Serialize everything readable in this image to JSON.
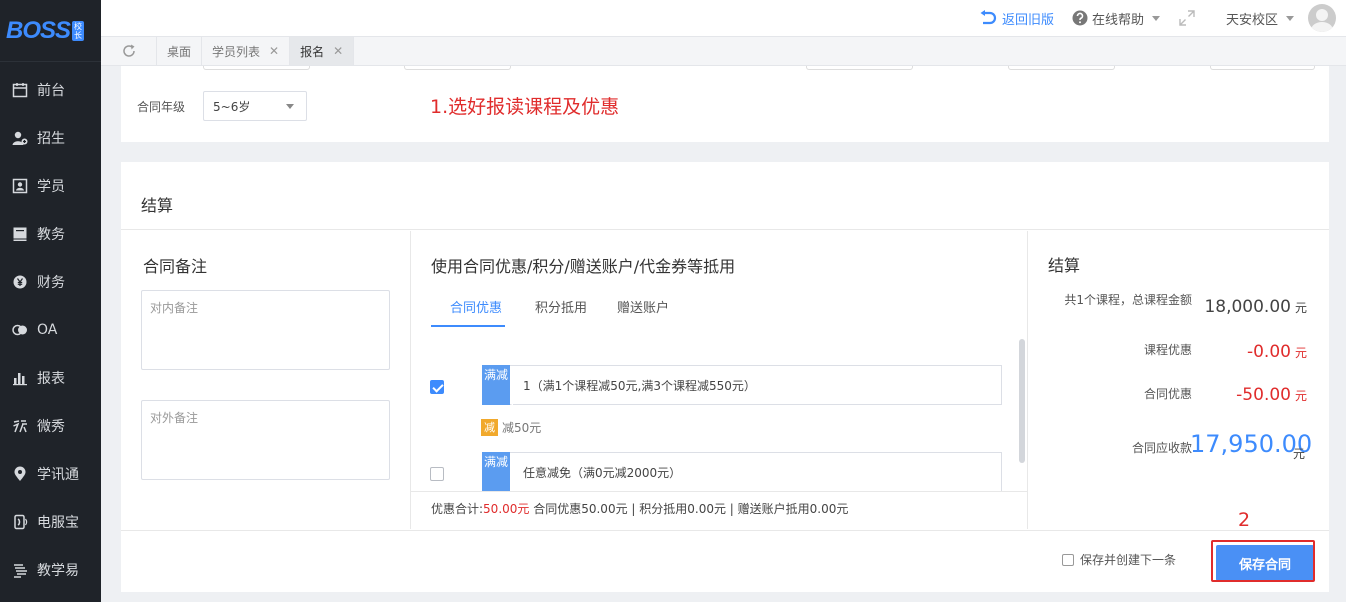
{
  "brand": {
    "logo": "BOSS",
    "tag": "校长"
  },
  "sidebar": {
    "items": [
      {
        "label": "前台",
        "icon": "calendar-icon"
      },
      {
        "label": "招生",
        "icon": "user-add-icon"
      },
      {
        "label": "学员",
        "icon": "id-card-icon"
      },
      {
        "label": "教务",
        "icon": "book-icon"
      },
      {
        "label": "财务",
        "icon": "yen-coin-icon"
      },
      {
        "label": "OA",
        "icon": "toggle-icon"
      },
      {
        "label": "报表",
        "icon": "bar-chart-icon"
      },
      {
        "label": "微秀",
        "icon": "show-icon"
      },
      {
        "label": "学讯通",
        "icon": "location-pin-icon"
      },
      {
        "label": "电服宝",
        "icon": "phone-service-icon"
      },
      {
        "label": "教学易",
        "icon": "teaching-icon"
      }
    ]
  },
  "header": {
    "back_old": "返回旧版",
    "help": "在线帮助",
    "campus": "天安校区"
  },
  "tabs": [
    {
      "label": "桌面",
      "closable": false,
      "active": false
    },
    {
      "label": "学员列表",
      "closable": true,
      "active": false
    },
    {
      "label": "报名",
      "closable": true,
      "active": true
    }
  ],
  "contract_grade": {
    "label": "合同年级",
    "value": "5~6岁"
  },
  "annotations": {
    "step1": "1.选好报读课程及优惠",
    "step2": "2"
  },
  "settlement": {
    "card_title": "结算",
    "notes": {
      "title": "合同备注",
      "internal_placeholder": "对内备注",
      "external_placeholder": "对外备注"
    },
    "discounts": {
      "title": "使用合同优惠/积分/赠送账户/代金券等抵用",
      "tabs": [
        "合同优惠",
        "积分抵用",
        "赠送账户"
      ],
      "coupons": [
        {
          "badge": "满减",
          "text": "1（满1个课程减50元,满3个课程减550元）",
          "checked": true,
          "reduce_tag": "减",
          "reduce_text": "减50元"
        },
        {
          "badge": "满减",
          "text": "任意减免（满0元减2000元）",
          "checked": false
        }
      ],
      "summary": {
        "prefix": "优惠合计:",
        "total": "50.00元",
        "rest": " 合同优惠50.00元 | 积分抵用0.00元 | 赠送账户抵用0.00元"
      }
    },
    "summary": {
      "title": "结算",
      "course_total_label": "共1个课程，总课程金额",
      "course_total_value": "18,000.00",
      "course_discount_label": "课程优惠",
      "course_discount_value": "-0.00",
      "contract_discount_label": "合同优惠",
      "contract_discount_value": "-50.00",
      "receivable_label": "合同应收款",
      "receivable_value": "17,950.00",
      "unit": "元"
    },
    "footer": {
      "save_and_new": "保存并创建下一条",
      "save_button": "保存合同"
    }
  },
  "colors": {
    "accent": "#3d8bfd",
    "danger": "#e02c2c",
    "sidebar_bg": "#1f2329"
  }
}
